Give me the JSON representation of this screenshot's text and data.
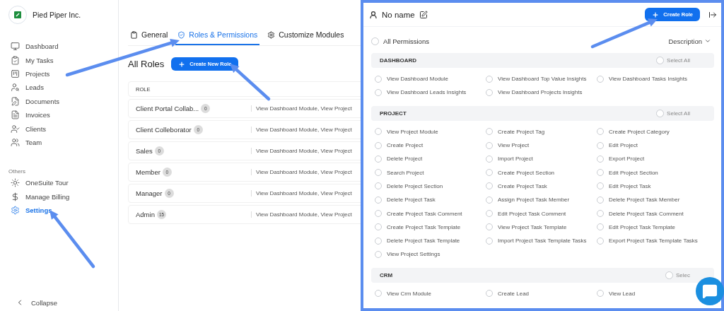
{
  "sidebar": {
    "company": "Pied Piper Inc.",
    "nav": [
      {
        "label": "Dashboard",
        "selected": false
      },
      {
        "label": "My Tasks",
        "selected": false
      },
      {
        "label": "Projects",
        "selected": false
      },
      {
        "label": "Leads",
        "selected": false
      },
      {
        "label": "Documents",
        "selected": false
      },
      {
        "label": "Invoices",
        "selected": false
      },
      {
        "label": "Clients",
        "selected": false
      },
      {
        "label": "Team",
        "selected": false
      }
    ],
    "others_label": "Others",
    "others": [
      {
        "label": "OneSuite Tour",
        "selected": false
      },
      {
        "label": "Manage Billing",
        "selected": false
      },
      {
        "label": "Settings",
        "selected": true
      }
    ],
    "collapse": "Collapse"
  },
  "main": {
    "tabs": [
      {
        "label": "General",
        "selected": false
      },
      {
        "label": "Roles & Permissions",
        "selected": true
      },
      {
        "label": "Customize Modules",
        "selected": false
      }
    ],
    "title": "All Roles",
    "create_button": "Create New Role",
    "table": {
      "column": "ROLE",
      "rows": [
        {
          "name": "Client Portal Collab...",
          "count": "0",
          "permissions": "View Dashboard Module, View Project"
        },
        {
          "name": "Client Colleborator",
          "count": "0",
          "permissions": "View Dashboard Module, View Project"
        },
        {
          "name": "Sales",
          "count": "0",
          "permissions": "View Dashboard Module, View Project"
        },
        {
          "name": "Member",
          "count": "0",
          "permissions": "View Dashboard Module, View Project"
        },
        {
          "name": "Manager",
          "count": "0",
          "permissions": "View Dashboard Module, View Project"
        },
        {
          "name": "Admin",
          "count": "15",
          "permissions": "View Dashboard Module, View Project"
        }
      ]
    }
  },
  "panel": {
    "title": "No name",
    "create_button": "Create Role",
    "all_permissions": {
      "label": "All Permissions",
      "checked": false
    },
    "description": "Description",
    "sections": [
      {
        "name": "DASHBOARD",
        "select_label": "Select All",
        "select_checked": false,
        "permissions": [
          {
            "label": "View Dashboard Module",
            "checked": false
          },
          {
            "label": "View Dashboard Top Value Insights",
            "checked": false
          },
          {
            "label": "View Dashboard Tasks Insights",
            "checked": false
          },
          {
            "label": "View Dashboard Leads Insights",
            "checked": false
          },
          {
            "label": "View Dashboard Projects Insights",
            "checked": false
          }
        ]
      },
      {
        "name": "PROJECT",
        "select_label": "Select All",
        "select_checked": false,
        "permissions": [
          {
            "label": "View Project Module",
            "checked": false
          },
          {
            "label": "Create Project Tag",
            "checked": false
          },
          {
            "label": "Create Project Category",
            "checked": false
          },
          {
            "label": "Create Project",
            "checked": false
          },
          {
            "label": "View Project",
            "checked": false
          },
          {
            "label": "Edit Project",
            "checked": false
          },
          {
            "label": "Delete Project",
            "checked": false
          },
          {
            "label": "Import Project",
            "checked": false
          },
          {
            "label": "Export Project",
            "checked": false
          },
          {
            "label": "Search Project",
            "checked": false
          },
          {
            "label": "Create Project Section",
            "checked": false
          },
          {
            "label": "Edit Project Section",
            "checked": false
          },
          {
            "label": "Delete Project Section",
            "checked": false
          },
          {
            "label": "Create Project Task",
            "checked": false
          },
          {
            "label": "Edit Project Task",
            "checked": false
          },
          {
            "label": "Delete Project Task",
            "checked": false
          },
          {
            "label": "Assign Project Task Member",
            "checked": false
          },
          {
            "label": "Delete Project Task Member",
            "checked": false
          },
          {
            "label": "Create Project Task Comment",
            "checked": false
          },
          {
            "label": "Edit Project Task Comment",
            "checked": false
          },
          {
            "label": "Delete Project Task Comment",
            "checked": false
          },
          {
            "label": "Create Project Task Template",
            "checked": false
          },
          {
            "label": "View Project Task Template",
            "checked": false
          },
          {
            "label": "Edit Project Task Template",
            "checked": false
          },
          {
            "label": "Delete Project Task Template",
            "checked": false
          },
          {
            "label": "Import Project Task Template Tasks",
            "checked": false
          },
          {
            "label": "Export Project Task Template Tasks",
            "checked": false
          },
          {
            "label": "View Project Settings",
            "checked": false
          }
        ]
      },
      {
        "name": "CRM",
        "select_label": "Selec",
        "select_checked": false,
        "permissions": [
          {
            "label": "View Crm Module",
            "checked": false
          },
          {
            "label": "Create Lead",
            "checked": false
          },
          {
            "label": "View Lead",
            "checked": false
          }
        ]
      }
    ]
  }
}
